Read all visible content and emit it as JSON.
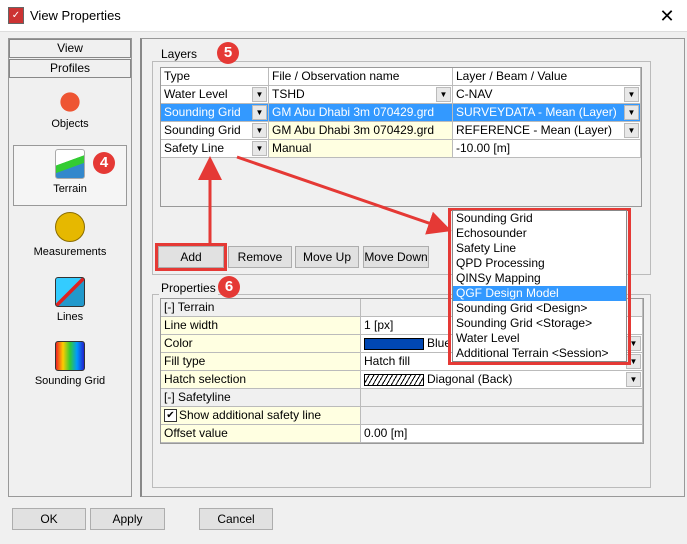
{
  "window": {
    "title": "View Properties",
    "close": "✕"
  },
  "sidebar": {
    "tabs": [
      "View",
      "Profiles"
    ],
    "items": [
      {
        "label": "Objects"
      },
      {
        "label": "Terrain"
      },
      {
        "label": "Measurements"
      },
      {
        "label": "Lines"
      },
      {
        "label": "Sounding Grid"
      }
    ]
  },
  "badges": {
    "b4": "4",
    "b5": "5",
    "b6": "6"
  },
  "layers": {
    "title": "Layers",
    "columns": [
      "Type",
      "File / Observation name",
      "Layer / Beam / Value"
    ],
    "rows": [
      {
        "type": "Water Level",
        "file": "TSHD",
        "layer": "C-NAV"
      },
      {
        "type": "Sounding Grid",
        "file": "GM Abu Dhabi 3m 070429.grd",
        "layer": "SURVEYDATA - Mean (Layer)"
      },
      {
        "type": "Sounding Grid",
        "file": "GM Abu Dhabi 3m 070429.grd",
        "layer": "REFERENCE - Mean (Layer)"
      },
      {
        "type": "Safety Line",
        "file": "Manual",
        "layer": "-10.00 [m]"
      }
    ],
    "buttons": {
      "add": "Add",
      "remove": "Remove",
      "move_up": "Move Up",
      "move_down": "Move Down"
    }
  },
  "dropdown": {
    "options": [
      "Sounding Grid",
      "Echosounder",
      "Safety Line",
      "QPD Processing",
      "QINSy Mapping",
      "QGF Design Model",
      "Sounding Grid <Design>",
      "Sounding Grid <Storage>",
      "Water Level",
      "Additional Terrain <Session>"
    ],
    "selected": "QGF Design Model"
  },
  "properties": {
    "title": "Properties",
    "rows": [
      {
        "name": "[-] Terrain",
        "value": ""
      },
      {
        "name": "Line width",
        "value": "1 [px]"
      },
      {
        "name": "Color",
        "value": "Blue"
      },
      {
        "name": "Fill type",
        "value": "Hatch fill"
      },
      {
        "name": "Hatch selection",
        "value": "Diagonal (Back)"
      },
      {
        "name": "[-] Safetyline",
        "value": ""
      },
      {
        "name": "Show additional safety line",
        "value": ""
      },
      {
        "name": "Offset value",
        "value": "0.00 [m]"
      }
    ],
    "color_swatch": "#0047b3",
    "checked": true
  },
  "footer": {
    "ok": "OK",
    "apply": "Apply",
    "cancel": "Cancel"
  },
  "colors": {
    "accent": "#3399ff",
    "annotation": "#e53935",
    "yellow_cell": "#ffffe1"
  }
}
